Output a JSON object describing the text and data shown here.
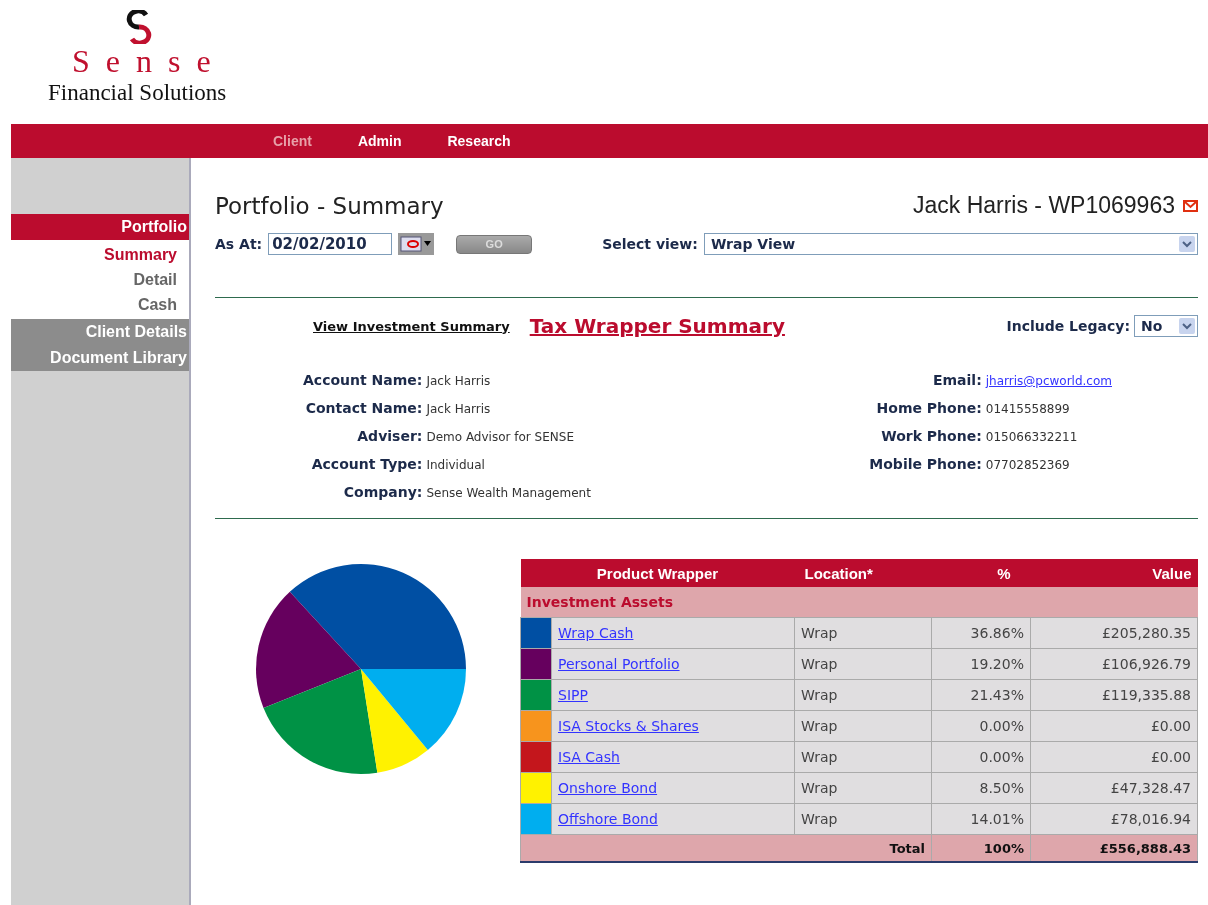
{
  "logo": {
    "name": "Sense",
    "tagline": "Financial Solutions"
  },
  "nav": [
    {
      "label": "Client",
      "selected": true
    },
    {
      "label": "Admin",
      "selected": false
    },
    {
      "label": "Research",
      "selected": false
    }
  ],
  "sidebar": {
    "items": [
      {
        "label": "Portfolio",
        "selected": true,
        "children": [
          {
            "label": "Summary",
            "selected": true
          },
          {
            "label": "Detail",
            "selected": false
          },
          {
            "label": "Cash",
            "selected": false
          }
        ]
      },
      {
        "label": "Client Details",
        "selected": false
      },
      {
        "label": "Document Library",
        "selected": false
      }
    ]
  },
  "page": {
    "title": "Portfolio - Summary",
    "client": "Jack Harris - WP1069963"
  },
  "as_at": {
    "label": "As At:",
    "value": "02/02/2010",
    "go": "GO"
  },
  "select_view": {
    "label": "Select view:",
    "value": "Wrap View"
  },
  "summary_links": [
    {
      "label": "View Investment Summary",
      "selected": false
    },
    {
      "label": "Tax Wrapper Summary",
      "selected": true
    }
  ],
  "include_legacy": {
    "label": "Include Legacy:",
    "value": "No"
  },
  "details_left": [
    {
      "label": "Account Name:",
      "value": "Jack Harris"
    },
    {
      "label": "Contact Name:",
      "value": "Jack Harris"
    },
    {
      "label": "Adviser:",
      "value": "Demo Advisor for SENSE"
    },
    {
      "label": "Account Type:",
      "value": "Individual"
    },
    {
      "label": "Company:",
      "value": "Sense Wealth Management"
    }
  ],
  "details_right": [
    {
      "label": "Email:",
      "value": "jharris@pcworld.com",
      "kind": "link"
    },
    {
      "label": "Home Phone:",
      "value": "01415558899",
      "kind": "text"
    },
    {
      "label": "Work Phone:",
      "value": "015066332211",
      "kind": "text"
    },
    {
      "label": "Mobile Phone:",
      "value": "07702852369",
      "kind": "text"
    }
  ],
  "table": {
    "columns": [
      "Product Wrapper",
      "Location*",
      "%",
      "Value"
    ],
    "group": "Investment Assets",
    "rows": [
      {
        "name": "Wrap Cash",
        "location": "Wrap",
        "percent": "36.86%",
        "value": "£205,280.35",
        "color": "#004fa3"
      },
      {
        "name": "Personal Portfolio",
        "location": "Wrap",
        "percent": "19.20%",
        "value": "£106,926.79",
        "color": "#66005e"
      },
      {
        "name": "SIPP",
        "location": "Wrap",
        "percent": "21.43%",
        "value": "£119,335.88",
        "color": "#009245"
      },
      {
        "name": "ISA Stocks & Shares",
        "location": "Wrap",
        "percent": "0.00%",
        "value": "£0.00",
        "color": "#f7941d"
      },
      {
        "name": "ISA Cash",
        "location": "Wrap",
        "percent": "0.00%",
        "value": "£0.00",
        "color": "#c4161c"
      },
      {
        "name": "Onshore Bond",
        "location": "Wrap",
        "percent": "8.50%",
        "value": "£47,328.47",
        "color": "#fff200"
      },
      {
        "name": "Offshore Bond",
        "location": "Wrap",
        "percent": "14.01%",
        "value": "£78,016.94",
        "color": "#00aeef"
      }
    ],
    "total": {
      "label": "Total",
      "percent": "100%",
      "value": "£556,888.43"
    }
  }
}
